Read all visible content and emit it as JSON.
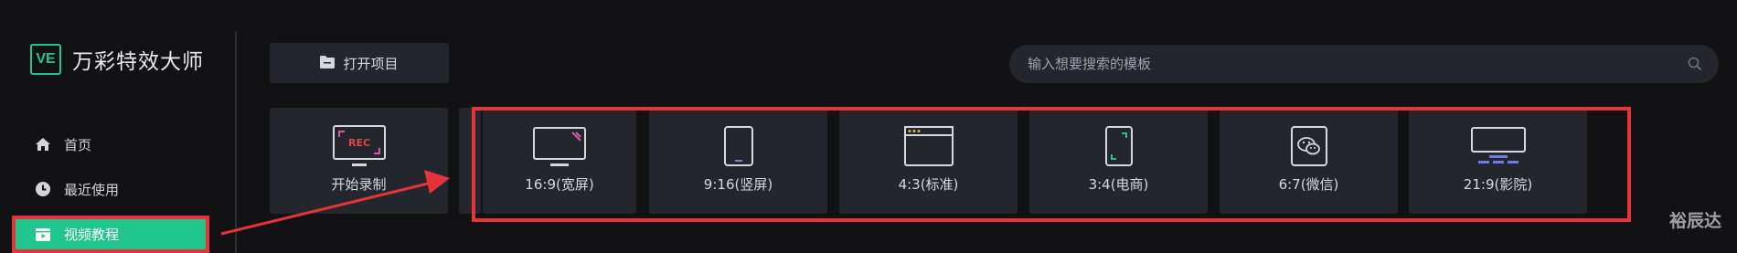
{
  "app": {
    "logo_mark": "VE",
    "name": "万彩特效大师"
  },
  "sidebar": {
    "items": [
      {
        "label": "首页",
        "icon": "home-icon"
      },
      {
        "label": "最近使用",
        "icon": "clock-icon"
      },
      {
        "label": "视频教程",
        "icon": "video-tutorial-icon",
        "active": true
      }
    ]
  },
  "toolbar": {
    "open_project_label": "打开项目",
    "open_project_icon": "folder-icon"
  },
  "search": {
    "placeholder": "输入想要搜索的模板",
    "icon": "search-icon"
  },
  "record_card": {
    "label": "开始录制",
    "badge": "REC",
    "icon": "screen-record-icon"
  },
  "ratio_cards": [
    {
      "label": "16:9(宽屏)",
      "icon": "widescreen-monitor-icon"
    },
    {
      "label": "9:16(竖屏)",
      "icon": "portrait-phone-icon"
    },
    {
      "label": "4:3(标准)",
      "icon": "standard-window-icon"
    },
    {
      "label": "3:4(电商)",
      "icon": "ecommerce-phone-icon"
    },
    {
      "label": "6:7(微信)",
      "icon": "wechat-icon"
    },
    {
      "label": "21:9(影院)",
      "icon": "cinema-screen-icon"
    }
  ],
  "colors": {
    "accent": "#21c58e",
    "annotation_red": "#e6333a",
    "background": "#121215",
    "card": "#24262d",
    "icon_pink": "#d65aa8",
    "icon_purple": "#9b6bd9",
    "icon_yellow": "#e3b93a",
    "icon_blue": "#6b7de0"
  },
  "watermark": "裕辰达"
}
